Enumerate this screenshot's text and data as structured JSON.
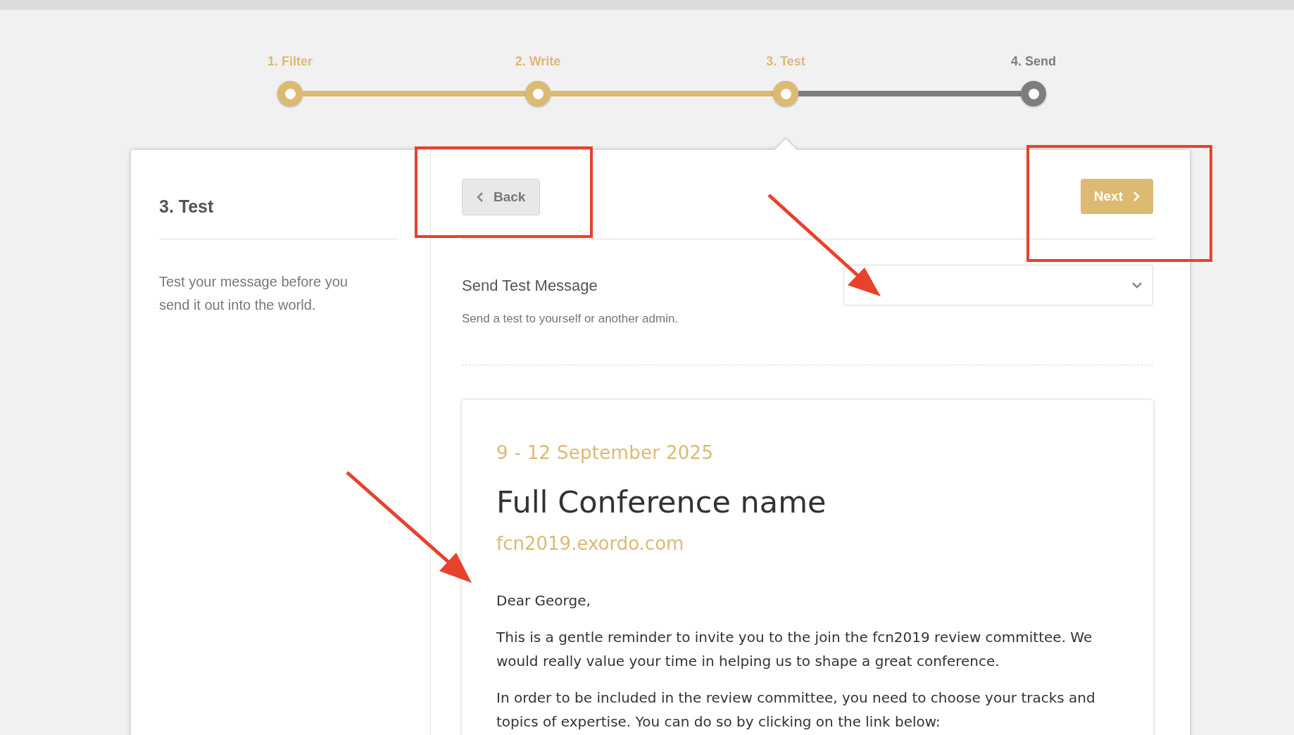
{
  "steps": [
    {
      "label": "1. Filter",
      "done": true,
      "selected": false
    },
    {
      "label": "2. Write",
      "done": true,
      "selected": false
    },
    {
      "label": "3. Test",
      "done": true,
      "selected": true
    },
    {
      "label": "4. Send",
      "done": false,
      "selected": false
    }
  ],
  "sidebar": {
    "title": "3. Test",
    "description": "Test your message before you send it out into the world."
  },
  "actions": {
    "back": "Back",
    "next": "Next"
  },
  "test_message": {
    "title": "Send Test Message",
    "description": "Send a test to yourself or another admin."
  },
  "preview": {
    "date": "9 - 12 September 2025",
    "title": "Full Conference name",
    "url": "fcn2019.exordo.com",
    "paragraphs": [
      "Dear George,",
      "This is a gentle reminder to invite you to the join the fcn2019 review committee. We would really value your time in helping us to shape a great conference.",
      "In order to be included in the review committee, you need to choose your tracks and topics of expertise. You can do so by clicking on the link below:"
    ]
  }
}
